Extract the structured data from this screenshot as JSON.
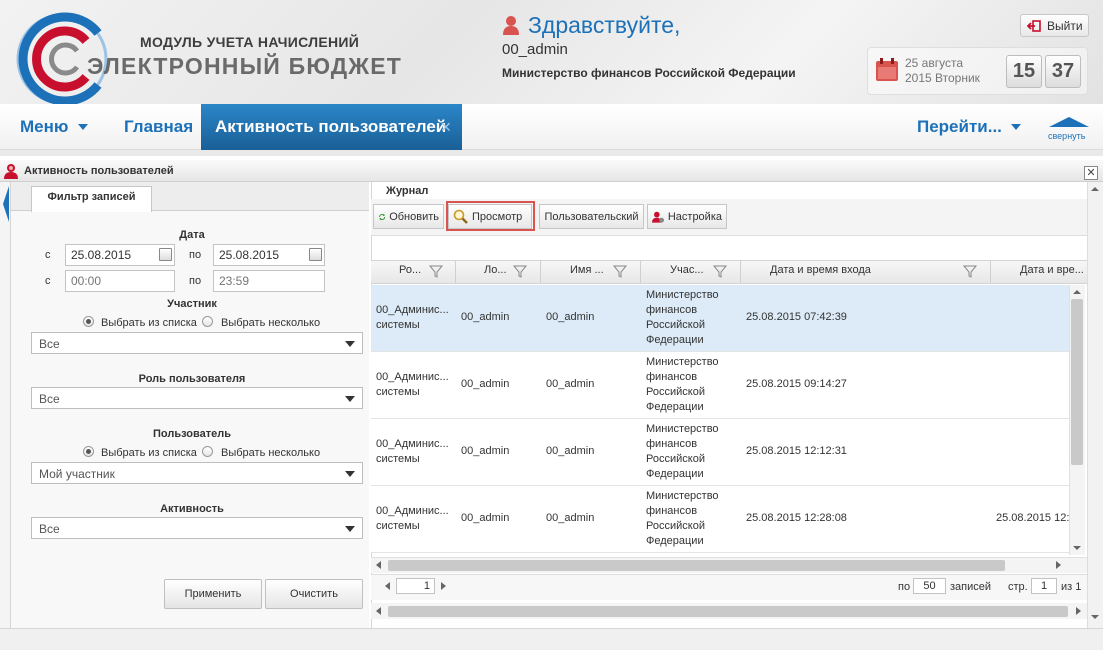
{
  "header": {
    "logo_subtitle": "МОДУЛЬ УЧЕТА НАЧИСЛЕНИЙ",
    "logo_title": "ЭЛЕКТРОННЫЙ БЮДЖЕТ",
    "greeting": "Здравствуйте,",
    "username": "00_admin",
    "organization": "Министерство финансов Российской Федерации",
    "logout_label": "Выйти",
    "date_line1": "25 августа",
    "date_line2": "2015 Вторник",
    "clock_hours": "15",
    "clock_minutes": "37"
  },
  "nav": {
    "menu_label": "Меню",
    "home_label": "Главная",
    "active_tab_label": "Активность пользователей",
    "goto_label": "Перейти...",
    "collapse_label": "свернуть"
  },
  "panel": {
    "title": "Активность пользователей"
  },
  "filter": {
    "tab_label": "Фильтр записей",
    "date_section": "Дата",
    "from_label": "с",
    "to_label": "по",
    "date_from": "25.08.2015",
    "date_to": "25.08.2015",
    "time_from_placeholder": "00:00",
    "time_to_placeholder": "23:59",
    "participant_section": "Участник",
    "radio_from_list": "Выбрать из списка",
    "radio_several": "Выбрать несколько",
    "participant_value": "Все",
    "role_section": "Роль пользователя",
    "role_value": "Все",
    "user_section": "Пользователь",
    "user_value": "Мой участник",
    "activity_section": "Активность",
    "activity_value": "Все",
    "apply_label": "Применить",
    "clear_label": "Очистить"
  },
  "journal": {
    "title": "Журнал",
    "toolbar": {
      "refresh": "Обновить",
      "view": "Просмотр",
      "custom": "Пользовательский",
      "settings": "Настройка"
    },
    "columns": [
      "Ро...",
      "Ло...",
      "Имя ...",
      "Учас...",
      "Дата и время входа",
      "Дата и вре..."
    ],
    "rows": [
      {
        "role": [
          "00_Админис...",
          "системы"
        ],
        "login": "00_admin",
        "name": "00_admin",
        "participant": [
          "Министерство",
          "финансов",
          "Российской",
          "Федерации"
        ],
        "login_time": "25.08.2015 07:42:39",
        "logout_time": ""
      },
      {
        "role": [
          "00_Админис...",
          "системы"
        ],
        "login": "00_admin",
        "name": "00_admin",
        "participant": [
          "Министерство",
          "финансов",
          "Российской",
          "Федерации"
        ],
        "login_time": "25.08.2015 09:14:27",
        "logout_time": ""
      },
      {
        "role": [
          "00_Админис...",
          "системы"
        ],
        "login": "00_admin",
        "name": "00_admin",
        "participant": [
          "Министерство",
          "финансов",
          "Российской",
          "Федерации"
        ],
        "login_time": "25.08.2015 12:12:31",
        "logout_time": ""
      },
      {
        "role": [
          "00_Админис...",
          "системы"
        ],
        "login": "00_admin",
        "name": "00_admin",
        "participant": [
          "Министерство",
          "финансов",
          "Российской",
          "Федерации"
        ],
        "login_time": "25.08.2015 12:28:08",
        "logout_time": "25.08.2015 12:"
      }
    ],
    "pager": {
      "page_value": "1",
      "per_label": "по",
      "per_value": "50",
      "records_label": "записей",
      "page_label": "стр.",
      "page_current": "1",
      "of_label": "из 1"
    }
  },
  "colors": {
    "brand_blue": "#1d71b8",
    "active_tab": "#1a5f97",
    "selected_row": "#dcebf7",
    "highlight_frame": "#d9534f",
    "accent_red": "#c8102e"
  }
}
